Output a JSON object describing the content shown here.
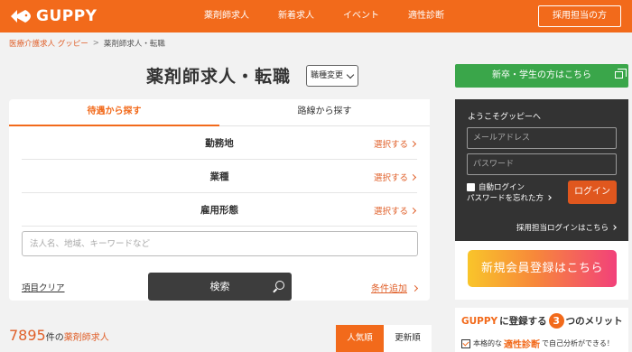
{
  "header": {
    "logo_text": "GUPPY",
    "nav": [
      "薬剤師求人",
      "新着求人",
      "イベント",
      "適性診断"
    ],
    "recruiter_button": "採用担当の方"
  },
  "breadcrumb": {
    "home": "医療介護求人 グッピー",
    "separator": ">",
    "current": "薬剤師求人・転職"
  },
  "title": "薬剤師求人・転職",
  "job_change_label": "職種変更",
  "tabs": {
    "active": "待遇から探す",
    "inactive": "路線から探す"
  },
  "criteria": [
    {
      "label": "勤務地",
      "select": "選択する"
    },
    {
      "label": "業種",
      "select": "選択する"
    },
    {
      "label": "雇用形態",
      "select": "選択する"
    }
  ],
  "keyword_placeholder": "法人名、地域、キーワードなど",
  "clear_label": "項目クリア",
  "search_label": "検索",
  "add_condition_label": "条件追加",
  "result": {
    "count": "7895",
    "unit": "件の",
    "kind": "薬剤師求人"
  },
  "sort": {
    "active": "人気順",
    "inactive": "更新順"
  },
  "sidebar": {
    "newgrad_button": "新卒・学生の方はこちら",
    "welcome": "ようこそグッピーへ",
    "email_placeholder": "メールアドレス",
    "password_placeholder": "パスワード",
    "auto_login": "自動ログイン",
    "forgot_password": "パスワードを忘れた方",
    "login_button": "ログイン",
    "recruiter_login": "採用担当ログインはこちら",
    "register_button": "新規会員登録はこちら",
    "merit": {
      "brand": "GUPPY",
      "text1": "に登録する",
      "number": "3",
      "text2": "つのメリット",
      "line_prefix": "本格的な",
      "line_highlight": "適性診断",
      "line_suffix": "で自己分析ができる！"
    }
  },
  "colors": {
    "brand_orange": "#f26a1b",
    "green": "#3aa64a",
    "dark": "#333333"
  }
}
